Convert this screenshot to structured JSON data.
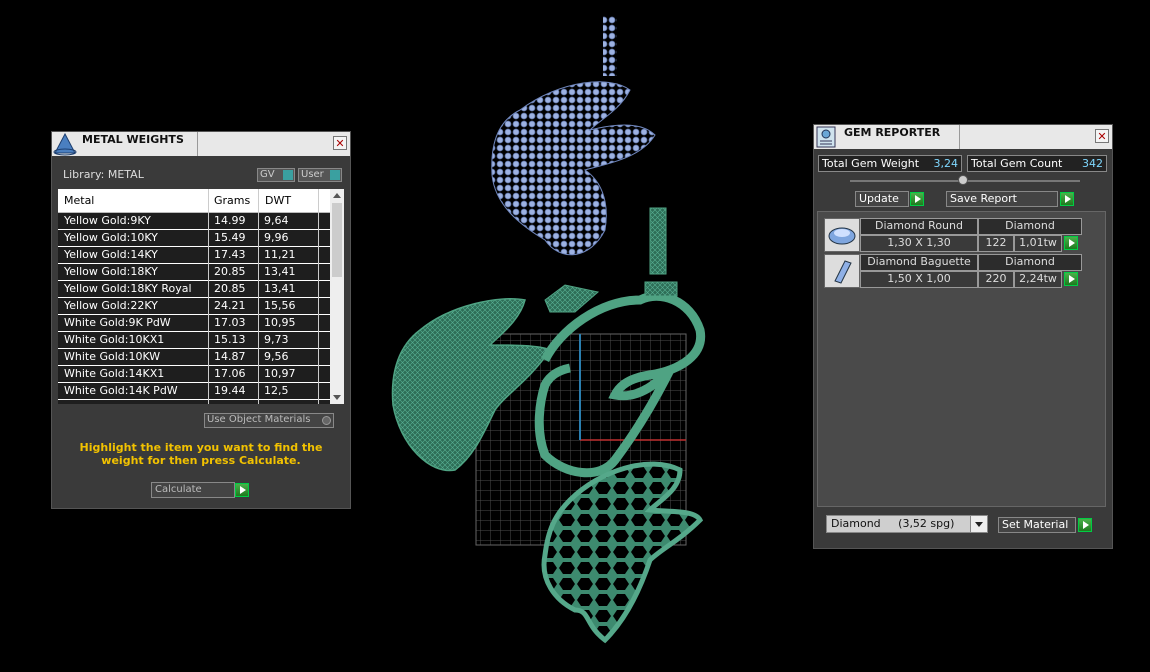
{
  "metal_panel": {
    "title": "METAL WEIGHTS",
    "library_label": "Library: METAL",
    "toggle_gv": "GV",
    "toggle_user": "User",
    "columns": [
      "Metal",
      "Grams",
      "DWT"
    ],
    "rows": [
      {
        "metal": "Yellow Gold:9KY",
        "grams": "14.99",
        "dwt": "9,64"
      },
      {
        "metal": "Yellow Gold:10KY",
        "grams": "15.49",
        "dwt": "9,96"
      },
      {
        "metal": "Yellow Gold:14KY",
        "grams": "17.43",
        "dwt": "11,21"
      },
      {
        "metal": "Yellow Gold:18KY",
        "grams": "20.85",
        "dwt": "13,41"
      },
      {
        "metal": "Yellow Gold:18KY Royal",
        "grams": "20.85",
        "dwt": "13,41"
      },
      {
        "metal": "Yellow Gold:22KY",
        "grams": "24.21",
        "dwt": "15,56"
      },
      {
        "metal": "White Gold:9K PdW",
        "grams": "17.03",
        "dwt": "10,95"
      },
      {
        "metal": "White Gold:10KX1",
        "grams": "15.13",
        "dwt": "9,73"
      },
      {
        "metal": "White Gold:10KW",
        "grams": "14.87",
        "dwt": "9,56"
      },
      {
        "metal": "White Gold:14KX1",
        "grams": "17.06",
        "dwt": "10,97"
      },
      {
        "metal": "White Gold:14K PdW",
        "grams": "19.44",
        "dwt": "12,5"
      }
    ],
    "use_object_materials": "Use Object Materials",
    "instruction": "Highlight the item you want to find the weight for then press Calculate.",
    "calculate": "Calculate"
  },
  "gem_panel": {
    "title": "GEM REPORTER",
    "total_weight_label": "Total Gem Weight",
    "total_weight_value": "3,24",
    "total_count_label": "Total Gem Count",
    "total_count_value": "342",
    "update": "Update",
    "save_report": "Save Report",
    "gems": [
      {
        "name": "Diamond Round",
        "material": "Diamond",
        "size": "1,30 X 1,30",
        "count": "122",
        "weight": "1,01tw"
      },
      {
        "name": "Diamond Baguette",
        "material": "Diamond",
        "size": "1,50 X 1,00",
        "count": "220",
        "weight": "2,24tw"
      }
    ],
    "material_select": "Diamond     (3,52 spg)",
    "set_material": "Set Material"
  },
  "colors": {
    "gem_blue": "#8fa6d8",
    "metal_green": "#3f8f72",
    "grid": "#555555",
    "axis_red": "#c03030",
    "axis_blue": "#2a7fb0",
    "instruction_yellow": "#f2c200",
    "value_cyan": "#7fd8ff"
  },
  "icons": [
    "pyramid-icon",
    "close-icon",
    "gem-report-icon",
    "play-arrow-icon",
    "dropdown-arrow-icon"
  ]
}
